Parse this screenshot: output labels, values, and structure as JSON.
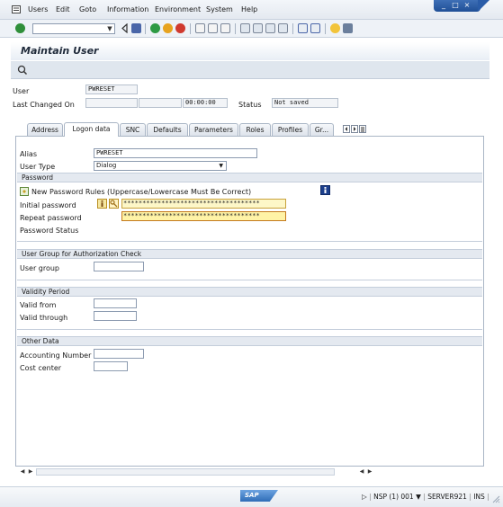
{
  "menu": {
    "items": [
      "Users",
      "Edit",
      "Goto",
      "Information",
      "Environment",
      "System",
      "Help"
    ]
  },
  "window_controls": {
    "minimize": "_",
    "maximize": "□",
    "close": "×"
  },
  "toolbar": {
    "command_field_value": "",
    "dropdown_arrow": "▼"
  },
  "page": {
    "title": "Maintain User"
  },
  "header": {
    "user_label": "User",
    "user_value": "PWRESET",
    "last_changed_label": "Last Changed On",
    "last_changed_date": "",
    "last_changed_user": "",
    "last_changed_time": "00:00:00",
    "status_label": "Status",
    "status_value": "Not saved"
  },
  "tabs": [
    {
      "label": "Address",
      "active": false
    },
    {
      "label": "Logon data",
      "active": true
    },
    {
      "label": "SNC",
      "active": false
    },
    {
      "label": "Defaults",
      "active": false
    },
    {
      "label": "Parameters",
      "active": false
    },
    {
      "label": "Roles",
      "active": false
    },
    {
      "label": "Profiles",
      "active": false
    },
    {
      "label": "Gr...",
      "active": false
    }
  ],
  "logon": {
    "alias_label": "Alias",
    "alias_value": "PWRESET",
    "user_type_label": "User Type",
    "user_type_value": "Dialog",
    "password_section": "Password",
    "password_rules": "New Password Rules (Uppercase/Lowercase Must Be Correct)",
    "initial_password_label": "Initial password",
    "initial_password_value": "************************************",
    "repeat_password_label": "Repeat password",
    "repeat_password_value": "************************************",
    "password_status_label": "Password Status",
    "user_group_section": "User Group for Authorization Check",
    "user_group_label": "User group",
    "user_group_value": "",
    "validity_section": "Validity Period",
    "valid_from_label": "Valid from",
    "valid_from_value": "",
    "valid_through_label": "Valid through",
    "valid_through_value": "",
    "other_section": "Other Data",
    "accounting_label": "Accounting Number",
    "accounting_value": "",
    "cost_center_label": "Cost center",
    "cost_center_value": ""
  },
  "statusbar": {
    "logo": "SAP",
    "system_info": "NSP (1) 001",
    "server": "SERVER921",
    "mode": "INS"
  },
  "colors": {
    "password_field_bg": "#fdf7c8",
    "section_bg": "#e4e9f0",
    "title_color": "#1f2a3a"
  }
}
